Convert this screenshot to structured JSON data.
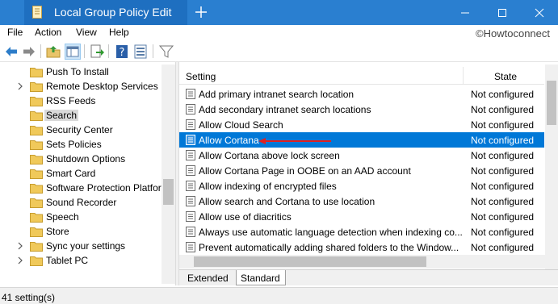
{
  "window": {
    "title": "Local Group Policy Edit",
    "accent": "#1e6fc0",
    "titlebar_color": "#2a7fd0"
  },
  "menu": [
    "File",
    "Action",
    "View",
    "Help"
  ],
  "watermark": "©Howtoconnect",
  "toolbar": {
    "buttons": [
      "back-arrow-icon",
      "forward-arrow-icon",
      "up-folder-icon",
      "show-hide-tree-icon",
      "export-list-icon",
      "help-icon",
      "properties-icon",
      "filter-icon"
    ]
  },
  "tree": {
    "items": [
      {
        "label": "Push To Install",
        "expandable": false
      },
      {
        "label": "Remote Desktop Services",
        "expandable": true
      },
      {
        "label": "RSS Feeds",
        "expandable": false
      },
      {
        "label": "Search",
        "expandable": false,
        "selected": true
      },
      {
        "label": "Security Center",
        "expandable": false
      },
      {
        "label": "Sets Policies",
        "expandable": false
      },
      {
        "label": "Shutdown Options",
        "expandable": false
      },
      {
        "label": "Smart Card",
        "expandable": false
      },
      {
        "label": "Software Protection Platfor",
        "expandable": false
      },
      {
        "label": "Sound Recorder",
        "expandable": false
      },
      {
        "label": "Speech",
        "expandable": false
      },
      {
        "label": "Store",
        "expandable": false
      },
      {
        "label": "Sync your settings",
        "expandable": true
      },
      {
        "label": "Tablet PC",
        "expandable": true
      }
    ]
  },
  "list": {
    "columns": {
      "setting": "Setting",
      "state": "State"
    },
    "rows": [
      {
        "name": "Add primary intranet search location",
        "state": "Not configured"
      },
      {
        "name": "Add secondary intranet search locations",
        "state": "Not configured"
      },
      {
        "name": "Allow Cloud Search",
        "state": "Not configured"
      },
      {
        "name": "Allow Cortana",
        "state": "Not configured",
        "selected": true
      },
      {
        "name": "Allow Cortana above lock screen",
        "state": "Not configured"
      },
      {
        "name": "Allow Cortana Page in OOBE on an AAD account",
        "state": "Not configured"
      },
      {
        "name": "Allow indexing of encrypted files",
        "state": "Not configured"
      },
      {
        "name": "Allow search and Cortana to use location",
        "state": "Not configured"
      },
      {
        "name": "Allow use of diacritics",
        "state": "Not configured"
      },
      {
        "name": "Always use automatic language detection when indexing co...",
        "state": "Not configured"
      },
      {
        "name": "Prevent automatically adding shared folders to the Window...",
        "state": "Not configured"
      }
    ],
    "selection_color": "#0078d7",
    "annotation_arrow_color": "#e02020"
  },
  "view_tabs": {
    "extended": "Extended",
    "standard": "Standard",
    "active": "Standard"
  },
  "status": {
    "text": "41 setting(s)"
  }
}
